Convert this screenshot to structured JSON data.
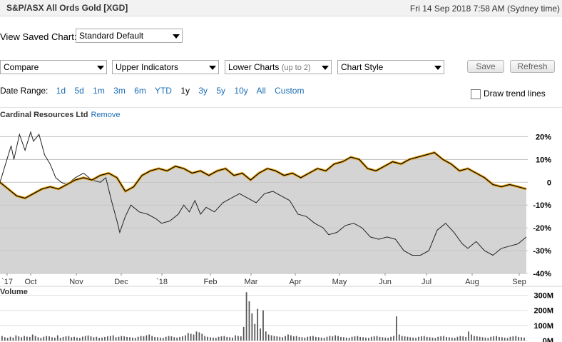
{
  "header": {
    "title": "S&P/ASX All Ords Gold [XGD]",
    "datetime": "Fri 14 Sep 2018 7:58 AM (Sydney time)"
  },
  "saved_chart": {
    "label": "View Saved Chart:",
    "value": "Standard Default"
  },
  "toolbar": {
    "compare": "Compare",
    "upper": "Upper Indicators",
    "lower": "Lower Charts",
    "lower_hint": "(up to 2)",
    "style": "Chart Style",
    "save": "Save",
    "refresh": "Refresh"
  },
  "date_range": {
    "label": "Date Range:",
    "options": [
      "1d",
      "5d",
      "1m",
      "3m",
      "6m",
      "YTD",
      "1y",
      "3y",
      "5y",
      "10y",
      "All",
      "Custom"
    ],
    "active": "1y"
  },
  "trend": {
    "label": "Draw trend lines",
    "checked": false
  },
  "comparison": {
    "name": "Cardinal Resources Ltd",
    "remove": "Remove"
  },
  "volume_label": "Volume",
  "colors": {
    "index_line": "#000000",
    "index_highlight": "#e8a820",
    "compare_line": "#222222",
    "area_fill": "#d4d4d4",
    "link": "#1a6db5"
  },
  "chart_data": [
    {
      "type": "line",
      "x_labels": [
        "`17",
        "Oct",
        "Nov",
        "Dec",
        "`18",
        "Feb",
        "Mar",
        "Apr",
        "May",
        "Jun",
        "Jul",
        "Aug",
        "Sep"
      ],
      "y_ticks": [
        "20%",
        "10%",
        "0",
        "-10%",
        "-20%",
        "-30%",
        "-40%"
      ],
      "ylim": [
        -40,
        22
      ],
      "series": [
        {
          "name": "S&P/ASX All Ords Gold [XGD]",
          "points": [
            [
              0,
              0
            ],
            [
              3,
              -3
            ],
            [
              6,
              -6
            ],
            [
              9,
              -7
            ],
            [
              12,
              -5
            ],
            [
              15,
              -3
            ],
            [
              18,
              -2
            ],
            [
              21,
              -3
            ],
            [
              24,
              -1
            ],
            [
              27,
              1
            ],
            [
              30,
              2
            ],
            [
              33,
              1
            ],
            [
              36,
              3
            ],
            [
              39,
              4
            ],
            [
              42,
              2
            ],
            [
              45,
              -4
            ],
            [
              48,
              -2
            ],
            [
              51,
              3
            ],
            [
              54,
              5
            ],
            [
              57,
              6
            ],
            [
              60,
              5
            ],
            [
              63,
              7
            ],
            [
              66,
              6
            ],
            [
              69,
              4
            ],
            [
              72,
              5
            ],
            [
              75,
              3
            ],
            [
              78,
              5
            ],
            [
              81,
              6
            ],
            [
              84,
              3
            ],
            [
              87,
              4
            ],
            [
              90,
              1
            ],
            [
              93,
              4
            ],
            [
              96,
              6
            ],
            [
              99,
              5
            ],
            [
              102,
              3
            ],
            [
              105,
              4
            ],
            [
              108,
              2
            ],
            [
              111,
              4
            ],
            [
              114,
              6
            ],
            [
              117,
              5
            ],
            [
              120,
              8
            ],
            [
              123,
              9
            ],
            [
              126,
              11
            ],
            [
              129,
              10
            ],
            [
              132,
              6
            ],
            [
              135,
              5
            ],
            [
              138,
              7
            ],
            [
              141,
              9
            ],
            [
              144,
              8
            ],
            [
              147,
              10
            ],
            [
              150,
              11
            ],
            [
              153,
              12
            ],
            [
              156,
              13
            ],
            [
              159,
              10
            ],
            [
              162,
              8
            ],
            [
              165,
              5
            ],
            [
              168,
              6
            ],
            [
              171,
              4
            ],
            [
              174,
              2
            ],
            [
              177,
              -1
            ],
            [
              180,
              -2
            ],
            [
              183,
              -1
            ],
            [
              186,
              -2
            ],
            [
              189,
              -3
            ]
          ]
        },
        {
          "name": "Cardinal Resources Ltd",
          "points": [
            [
              0,
              0
            ],
            [
              2,
              8
            ],
            [
              4,
              16
            ],
            [
              5,
              10
            ],
            [
              7,
              21
            ],
            [
              9,
              14
            ],
            [
              11,
              22
            ],
            [
              12,
              18
            ],
            [
              14,
              21
            ],
            [
              16,
              12
            ],
            [
              18,
              8
            ],
            [
              20,
              2
            ],
            [
              22,
              0
            ],
            [
              24,
              -1
            ],
            [
              27,
              2
            ],
            [
              30,
              4
            ],
            [
              33,
              1
            ],
            [
              36,
              0
            ],
            [
              38,
              2
            ],
            [
              40,
              -8
            ],
            [
              42,
              -17
            ],
            [
              43,
              -22
            ],
            [
              45,
              -15
            ],
            [
              47,
              -10
            ],
            [
              50,
              -13
            ],
            [
              53,
              -14
            ],
            [
              56,
              -16
            ],
            [
              58,
              -18
            ],
            [
              61,
              -17
            ],
            [
              64,
              -14
            ],
            [
              66,
              -10
            ],
            [
              68,
              -13
            ],
            [
              70,
              -8
            ],
            [
              72,
              -14
            ],
            [
              74,
              -11
            ],
            [
              77,
              -13
            ],
            [
              80,
              -9
            ],
            [
              83,
              -7
            ],
            [
              86,
              -5
            ],
            [
              89,
              -7
            ],
            [
              92,
              -9
            ],
            [
              95,
              -5
            ],
            [
              98,
              -4
            ],
            [
              101,
              -6
            ],
            [
              104,
              -8
            ],
            [
              107,
              -14
            ],
            [
              110,
              -15
            ],
            [
              113,
              -18
            ],
            [
              116,
              -20
            ],
            [
              118,
              -23
            ],
            [
              121,
              -22
            ],
            [
              124,
              -19
            ],
            [
              127,
              -18
            ],
            [
              130,
              -20
            ],
            [
              133,
              -24
            ],
            [
              136,
              -25
            ],
            [
              139,
              -24
            ],
            [
              142,
              -25
            ],
            [
              145,
              -30
            ],
            [
              148,
              -32
            ],
            [
              151,
              -32
            ],
            [
              154,
              -30
            ],
            [
              157,
              -21
            ],
            [
              160,
              -18
            ],
            [
              163,
              -22
            ],
            [
              166,
              -27
            ],
            [
              168,
              -29
            ],
            [
              171,
              -26
            ],
            [
              174,
              -30
            ],
            [
              177,
              -32
            ],
            [
              180,
              -29
            ],
            [
              183,
              -28
            ],
            [
              186,
              -27
            ],
            [
              189,
              -24
            ]
          ]
        }
      ]
    },
    {
      "type": "bar",
      "title": "Volume",
      "y_ticks": [
        "300M",
        "200M",
        "100M",
        "0M"
      ],
      "ylim": [
        0,
        340
      ],
      "values": [
        30,
        22,
        18,
        25,
        20,
        35,
        28,
        22,
        30,
        26,
        24,
        40,
        30,
        22,
        18,
        25,
        30,
        28,
        22,
        20,
        35,
        18,
        24,
        28,
        30,
        22,
        25,
        20,
        18,
        26,
        30,
        34,
        28,
        22,
        25,
        18,
        20,
        24,
        28,
        30,
        35,
        22,
        25,
        30,
        28,
        24,
        22,
        20,
        18,
        25,
        30,
        28,
        35,
        40,
        30,
        24,
        22,
        20,
        18,
        25,
        30,
        28,
        22,
        20,
        24,
        28,
        35,
        50,
        45,
        40,
        60,
        55,
        45,
        30,
        25,
        22,
        20,
        18,
        25,
        28,
        30,
        24,
        22,
        20,
        35,
        30,
        28,
        90,
        320,
        260,
        180,
        110,
        210,
        80,
        200,
        60,
        40,
        35,
        30,
        28,
        25,
        22,
        30,
        40,
        35,
        28,
        30,
        24,
        22,
        20,
        25,
        28,
        30,
        24,
        22,
        20,
        18,
        25,
        30,
        28,
        35,
        30,
        24,
        22,
        20,
        18,
        25,
        28,
        30,
        24,
        22,
        20,
        18,
        25,
        28,
        30,
        24,
        22,
        20,
        18,
        25,
        30,
        160,
        40,
        30,
        28,
        25,
        22,
        20,
        18,
        25,
        28,
        30,
        24,
        22,
        20,
        18,
        25,
        28,
        30,
        24,
        22,
        20,
        18,
        25,
        30,
        28,
        24,
        60,
        40,
        30,
        28,
        25,
        22,
        20,
        18,
        25,
        28,
        30,
        24,
        22,
        20,
        18,
        25,
        28,
        30,
        24,
        22,
        20
      ]
    }
  ]
}
